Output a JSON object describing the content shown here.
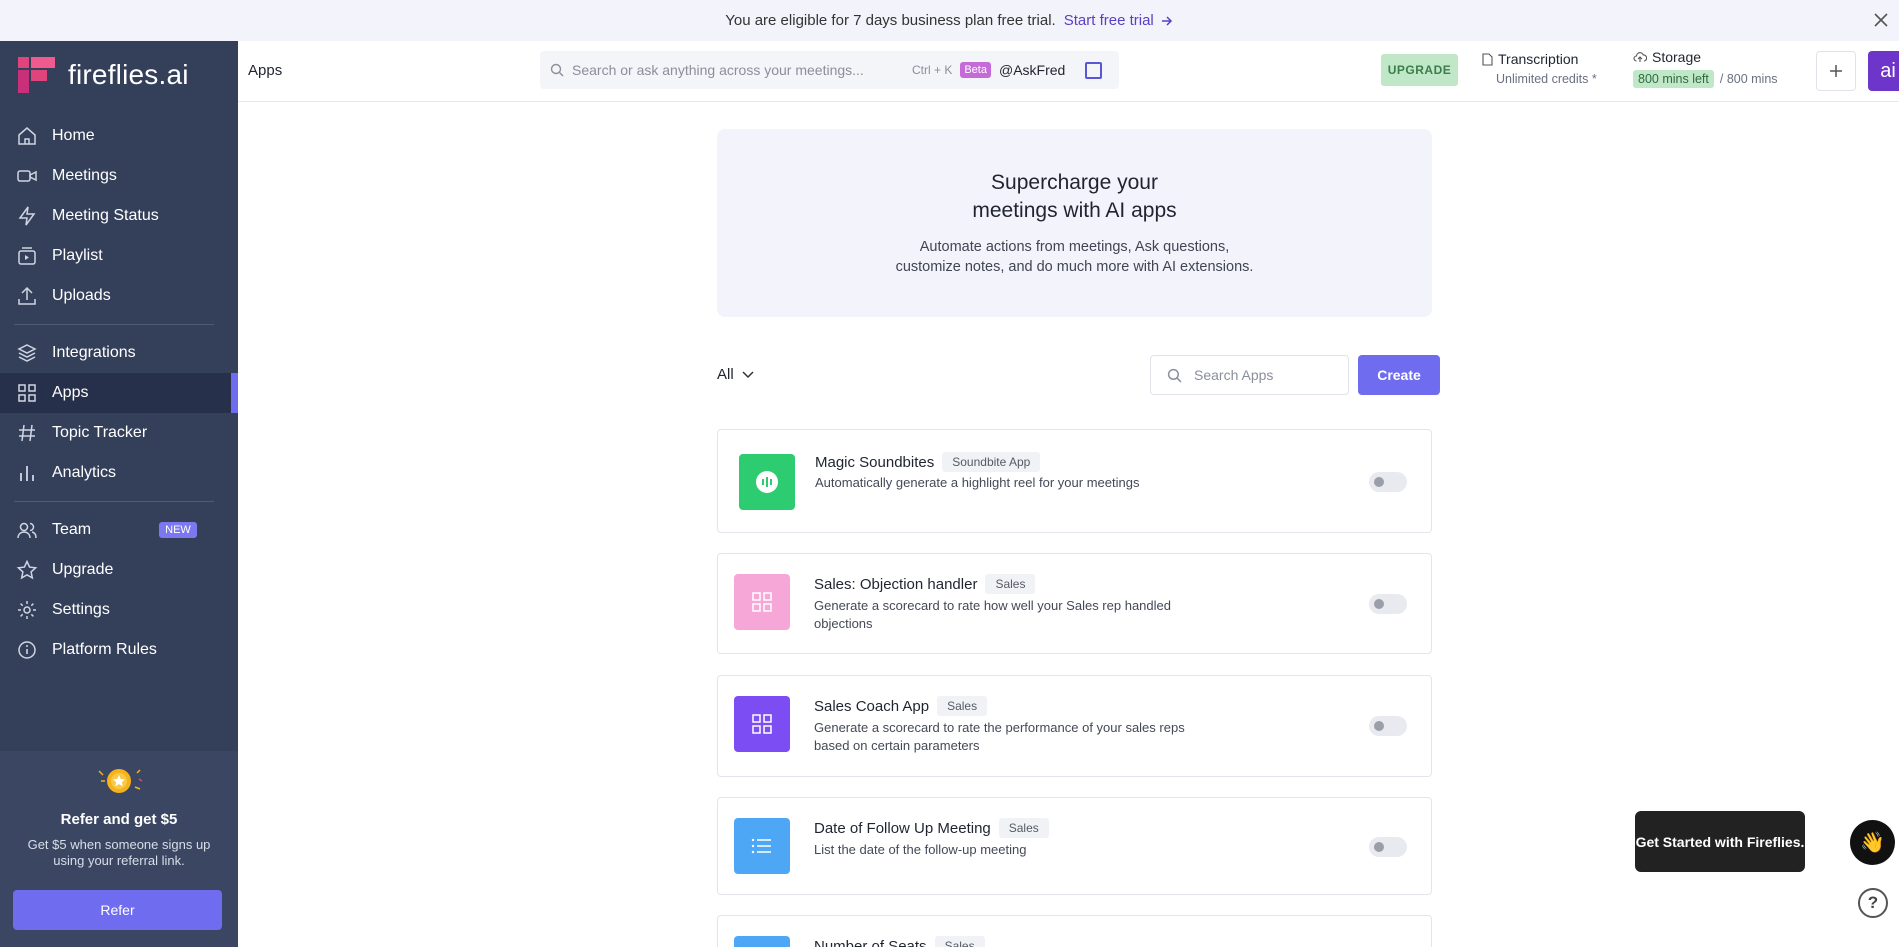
{
  "banner": {
    "text": "You are eligible for 7 days business plan free trial.",
    "link_label": "Start free trial"
  },
  "brand": {
    "name": "fireflies.ai"
  },
  "sidebar": {
    "items": [
      {
        "label": "Home",
        "icon": "home-icon"
      },
      {
        "label": "Meetings",
        "icon": "video-icon"
      },
      {
        "label": "Meeting Status",
        "icon": "lightning-icon"
      },
      {
        "label": "Playlist",
        "icon": "playlist-icon"
      },
      {
        "label": "Uploads",
        "icon": "upload-icon"
      },
      {
        "label": "Integrations",
        "icon": "layers-icon"
      },
      {
        "label": "Apps",
        "icon": "grid-icon",
        "active": true
      },
      {
        "label": "Topic Tracker",
        "icon": "hashtag-icon"
      },
      {
        "label": "Analytics",
        "icon": "bar-chart-icon"
      },
      {
        "label": "Team",
        "icon": "users-icon",
        "badge": "NEW"
      },
      {
        "label": "Upgrade",
        "icon": "star-icon"
      },
      {
        "label": "Settings",
        "icon": "gear-icon"
      },
      {
        "label": "Platform Rules",
        "icon": "info-icon"
      }
    ],
    "refer": {
      "title": "Refer and get $5",
      "description": "Get $5 when someone signs up using your referral link.",
      "button_label": "Refer"
    }
  },
  "header": {
    "title": "Apps",
    "search_placeholder": "Search or ask anything across your meetings...",
    "shortcut": "Ctrl + K",
    "beta_badge": "Beta",
    "askfred": "@AskFred",
    "upgrade_label": "UPGRADE",
    "transcription_label": "Transcription",
    "transcription_value": "Unlimited credits *",
    "storage_label": "Storage",
    "storage_left": "800 mins left",
    "storage_total": "/ 800 mins",
    "avatar_text": "ai"
  },
  "hero": {
    "title_line1": "Supercharge your",
    "title_line2": "meetings with AI apps",
    "desc_line1": "Automate actions from meetings, Ask questions,",
    "desc_line2": "customize notes, and do much more with AI extensions."
  },
  "filters": {
    "category": "All",
    "search_placeholder": "Search Apps",
    "create_label": "Create"
  },
  "apps": [
    {
      "name": "Magic Soundbites",
      "tag": "Soundbite App",
      "description": "Automatically generate a highlight reel for your meetings",
      "icon": "soundbite-icon",
      "color": "#2ecc71",
      "enabled": false
    },
    {
      "name": "Sales: Objection handler",
      "tag": "Sales",
      "description": "Generate a scorecard to rate how well your Sales rep handled objections",
      "icon": "grid-icon",
      "color": "#f7a6d8",
      "enabled": false
    },
    {
      "name": "Sales Coach App",
      "tag": "Sales",
      "description": "Generate a scorecard to rate the performance of your sales reps based on certain parameters",
      "icon": "grid-icon",
      "color": "#7c4df2",
      "enabled": false
    },
    {
      "name": "Date of Follow Up Meeting",
      "tag": "Sales",
      "description": "List the date of the follow-up meeting",
      "icon": "list-icon",
      "color": "#4ea7f5",
      "enabled": false
    },
    {
      "name": "Number of Seats",
      "tag": "Sales",
      "icon": "list-icon",
      "color": "#4ea7f5"
    }
  ],
  "tooltip": {
    "text": "Get Started with Fireflies.",
    "emoji": "👋"
  },
  "help": {
    "label": "?"
  }
}
